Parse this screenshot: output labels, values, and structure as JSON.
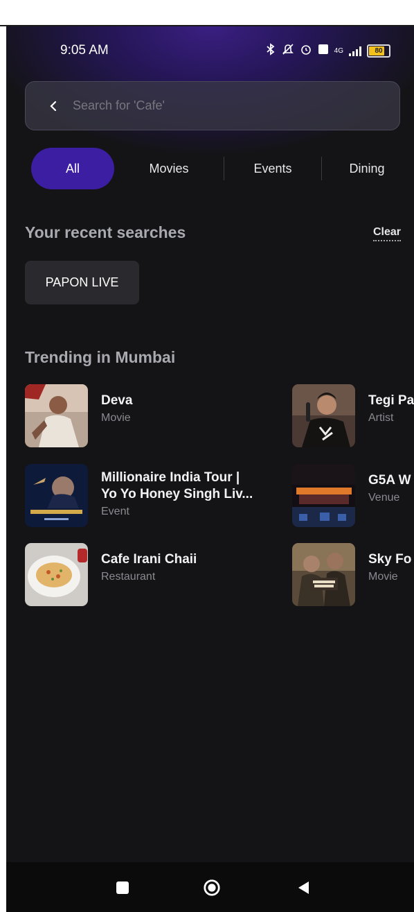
{
  "status_bar": {
    "time": "9:05 AM",
    "battery": "80",
    "network": "4G"
  },
  "search": {
    "placeholder": "Search for 'Cafe'"
  },
  "tabs": [
    {
      "label": "All",
      "active": true
    },
    {
      "label": "Movies",
      "active": false
    },
    {
      "label": "Events",
      "active": false
    },
    {
      "label": "Dining",
      "active": false
    }
  ],
  "recent": {
    "title": "Your recent searches",
    "clear_label": "Clear",
    "items": [
      "PAPON LIVE"
    ]
  },
  "trending": {
    "title": "Trending in Mumbai",
    "items": [
      {
        "name": "Deva",
        "type": "Movie"
      },
      {
        "name": "Tegi Pa",
        "type": "Artist"
      },
      {
        "name": "Millionaire India Tour |",
        "name2": "Yo Yo Honey Singh Liv...",
        "type": "Event"
      },
      {
        "name": "G5A W",
        "type": "Venue"
      },
      {
        "name": "Cafe Irani Chaii",
        "type": "Restaurant"
      },
      {
        "name": "Sky Fo",
        "type": "Movie"
      }
    ]
  },
  "nav": {
    "icons": [
      "recents-icon",
      "home-icon",
      "back-icon"
    ]
  },
  "colors": {
    "accent": "#3b1ea1",
    "background": "#141416"
  }
}
